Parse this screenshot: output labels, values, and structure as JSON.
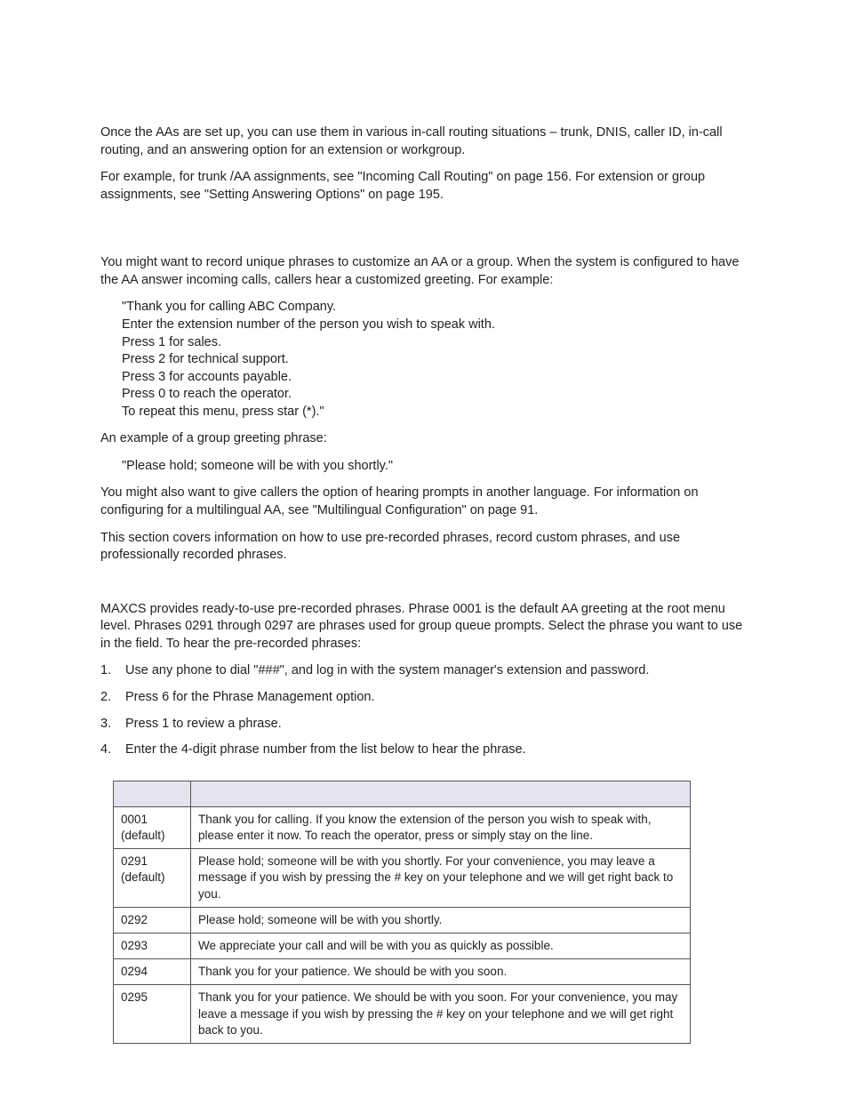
{
  "intro": {
    "p1": "Once the AAs are set up, you can use them in various in-call routing situations – trunk, DNIS, caller ID, in-call routing, and an answering option for an extension or workgroup.",
    "p2": "For example, for trunk /AA assignments, see \"Incoming Call Routing\" on page 156. For extension or group assignments, see \"Setting Answering Options\" on page 195."
  },
  "phrase_mgmt": {
    "p1": "You might want to record unique phrases to customize an AA or a group. When the system is configured to have the AA answer incoming calls, callers hear a customized greeting. For example:",
    "example_lines": [
      "\"Thank you for calling ABC Company.",
      "Enter the extension number of the person you wish to speak with.",
      "Press 1 for sales.",
      "Press 2 for technical support.",
      "Press 3 for accounts payable.",
      "Press 0 to reach the operator.",
      "To repeat this menu, press star (*).\""
    ],
    "p2": "An example of a group greeting phrase:",
    "example2": "\"Please hold; someone will be with you shortly.\"",
    "p3": "You might also want to give callers the option of hearing prompts in another language. For information on configuring for a multilingual AA, see \"Multilingual Configuration\" on page 91.",
    "p4": "This section covers information on how to use pre-recorded phrases, record custom phrases, and use professionally recorded phrases."
  },
  "prerecorded": {
    "p1_a": "MAXCS provides ready-to-use pre-recorded phrases. Phrase 0001 is the default AA greeting at the root menu level. Phrases 0291 through 0297 are phrases used for group queue prompts. Select the phrase you want to use in the ",
    "p1_b": " field. To hear the pre-recorded phrases:",
    "steps": [
      "Use any phone to dial \"###\", and log in with the system manager's extension and password.",
      "Press 6 for the Phrase Management option.",
      "Press 1 to review a phrase.",
      "Enter the 4-digit phrase number from the list below to hear the phrase."
    ]
  },
  "table": {
    "header_num": "",
    "header_text": "",
    "rows": [
      {
        "num": "0001 (default)",
        "text_a": "Thank you for calling. If you know the extension of the person you wish to speak with, please enter it now. To reach the operator, press ",
        "text_b": " or simply stay on the line."
      },
      {
        "num": "0291 (default)",
        "text": "Please hold; someone will be with you shortly. For your convenience, you may leave a message if you wish by pressing the # key on your telephone and we will get right back to you."
      },
      {
        "num": "0292",
        "text": "Please hold; someone will be with you shortly."
      },
      {
        "num": "0293",
        "text": "We appreciate your call and will be with you as quickly as possible."
      },
      {
        "num": "0294",
        "text": "Thank you for your patience. We should be with you soon."
      },
      {
        "num": "0295",
        "text": "Thank you for your patience. We should be with you soon. For your convenience, you may leave a message if you wish by pressing the # key on your telephone and we will get right back to you."
      }
    ]
  }
}
